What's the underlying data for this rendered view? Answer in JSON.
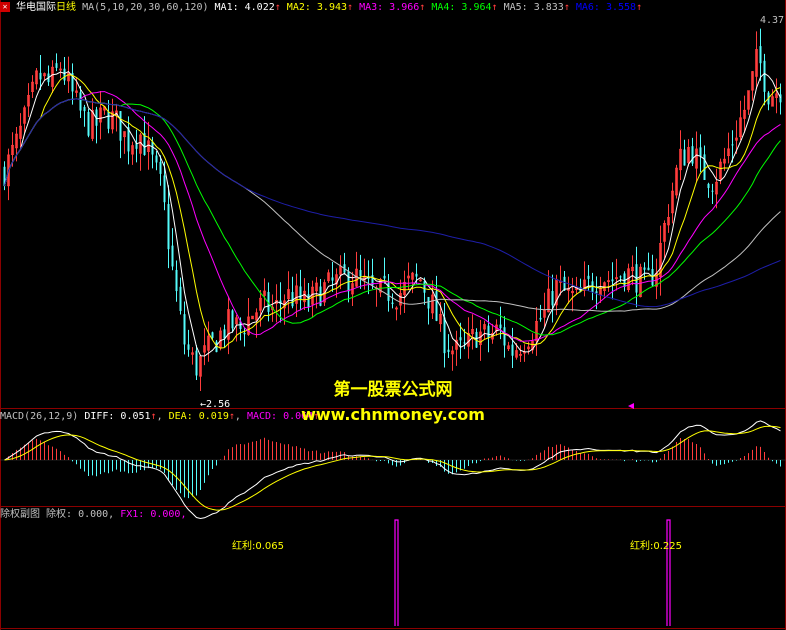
{
  "header": {
    "stock_name": "华电国际",
    "period": "日线",
    "ma_label": "MA(5,10,20,30,60,120)",
    "ma_values": [
      {
        "label": "MA1:",
        "value": "4.022",
        "color": "#ffffff"
      },
      {
        "label": "MA2:",
        "value": "3.943",
        "color": "#ffff00"
      },
      {
        "label": "MA3:",
        "value": "3.966",
        "color": "#ff00ff"
      },
      {
        "label": "MA4:",
        "value": "3.964",
        "color": "#00ff00"
      },
      {
        "label": "MA5:",
        "value": "3.833",
        "color": "#c0c0c0"
      },
      {
        "label": "MA6:",
        "value": "3.558",
        "color": "#0000ff"
      }
    ],
    "up_arrow": "↑",
    "top_right_price": "4.37"
  },
  "macd": {
    "label": "MACD(26,12,9)",
    "diff": "DIFF: 0.051",
    "dea": "DEA: 0.019",
    "macd": "MACD: 0.064"
  },
  "sub": {
    "label": "除权副图",
    "chuquan": "除权: 0.000,",
    "fx1": "FX1: 0.000,"
  },
  "annotations": {
    "low_price": "2.56",
    "dividend_1": "红利:0.065",
    "dividend_2": "红利:0.225"
  },
  "watermark": {
    "line1": "第一股票公式网",
    "line2": "www.chnmoney.com"
  },
  "colors": {
    "up": "#ff3c3c",
    "down": "#54fcfc",
    "grid": "#8b0000",
    "ma1": "#ffffff",
    "ma2": "#ffff00",
    "ma3": "#ff00ff",
    "ma4": "#00ff00",
    "ma5": "#c0c0c0",
    "ma6": "#1e1ea8"
  },
  "chart_data": {
    "type": "candlestick",
    "price_range": [
      2.45,
      4.45
    ],
    "price_trend": [
      3.65,
      3.78,
      3.95,
      4.15,
      4.1,
      4.2,
      4.05,
      3.92,
      3.88,
      3.95,
      3.9,
      3.8,
      3.85,
      3.72,
      3.55,
      3.1,
      2.75,
      2.62,
      2.7,
      2.78,
      2.85,
      2.82,
      2.9,
      2.95,
      2.92,
      3.0,
      2.98,
      2.95,
      3.02,
      3.05,
      3.08,
      3.1,
      3.05,
      3.0,
      3.02,
      3.0,
      3.06,
      3.08,
      2.95,
      2.78,
      2.7,
      2.72,
      2.8,
      2.78,
      2.82,
      2.7,
      2.75,
      2.82,
      2.9,
      3.05,
      3.0,
      2.98,
      3.05,
      3.1,
      3.08,
      3.12,
      3.1,
      3.05,
      3.15,
      3.45,
      3.7,
      3.78,
      3.65,
      3.6,
      3.7,
      3.85,
      4.0,
      4.25,
      4.05,
      4.08
    ],
    "dividends": [
      {
        "index": 35,
        "value": 0.065
      },
      {
        "index": 59,
        "value": 0.225
      }
    ]
  }
}
